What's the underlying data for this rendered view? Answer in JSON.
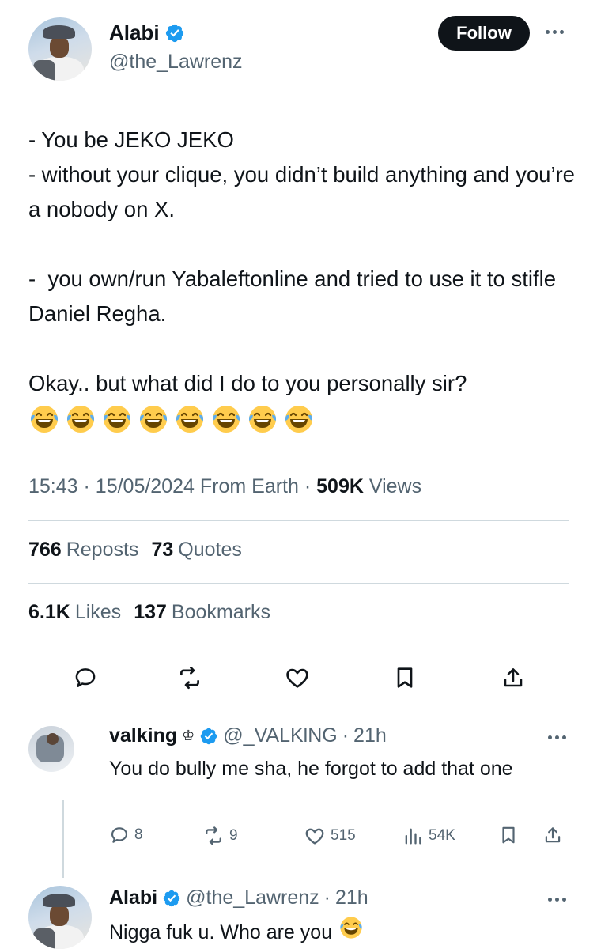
{
  "author": {
    "display_name": "Alabi",
    "handle": "@the_Lawrenz",
    "follow_label": "Follow"
  },
  "tweet": {
    "text": "- You be JEKO JEKO\n- without your clique, you didn’t build anything and you’re a nobody on X.\n\n-  you own/run Yabaleftonline and tried to use it to stifle Daniel Regha.\n\nOkay.. but what did I do to you personally sir?",
    "emoji_count": 8,
    "time": "15:43",
    "date": "15/05/2024",
    "source": "From Earth",
    "views_count": "509K",
    "views_label": "Views"
  },
  "stats": {
    "reposts_count": "766",
    "reposts_label": "Reposts",
    "quotes_count": "73",
    "quotes_label": "Quotes",
    "likes_count": "6.1K",
    "likes_label": "Likes",
    "bookmarks_count": "137",
    "bookmarks_label": "Bookmarks"
  },
  "replies": [
    {
      "display_name": "valking",
      "crown": "♔",
      "handle": "@_VALKlNG",
      "time": "21h",
      "text": "You do bully me sha, he forgot to add that one",
      "replies": "8",
      "reposts": "9",
      "likes": "515",
      "views": "54K"
    },
    {
      "display_name": "Alabi",
      "handle": "@the_Lawrenz",
      "time": "21h",
      "text": "Nigga fuk u. Who are you"
    }
  ],
  "colors": {
    "text": "#0f1419",
    "muted": "#536471",
    "divider": "#cfd9de",
    "verified": "#1d9bf0",
    "emoji_face": "#ffcc4d",
    "emoji_tear": "#5dadec"
  },
  "icons": [
    "verified-badge-icon",
    "more-icon",
    "reply-icon",
    "repost-icon",
    "like-icon",
    "bookmark-icon",
    "share-icon",
    "views-icon",
    "laughing-emoji-icon",
    "crown-icon"
  ]
}
